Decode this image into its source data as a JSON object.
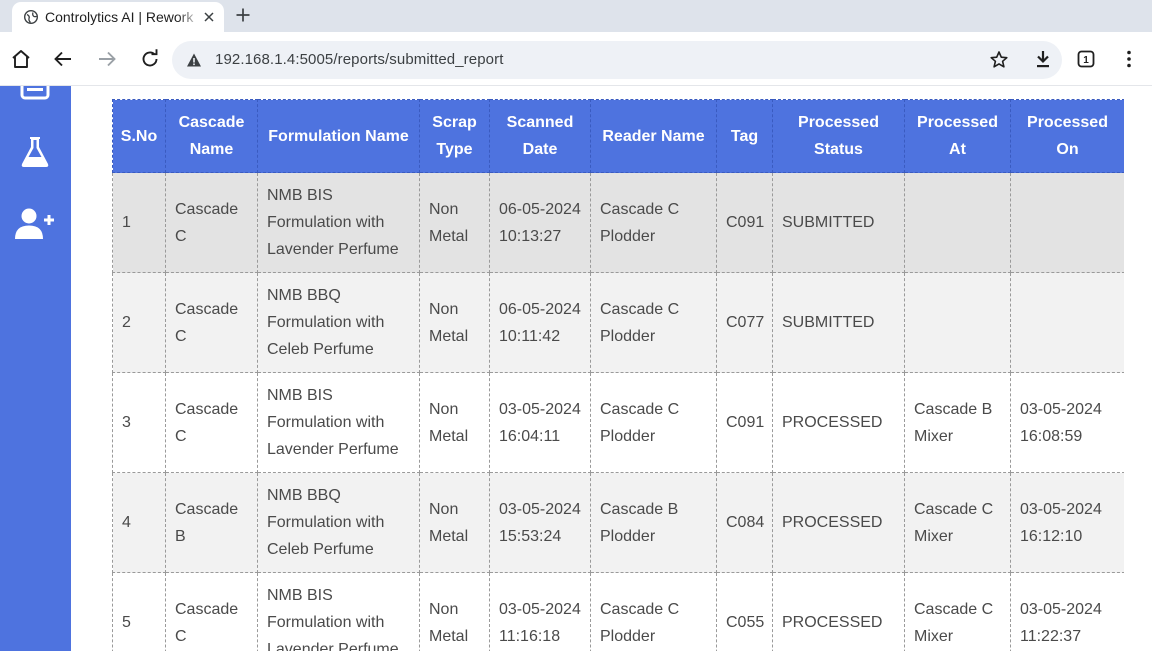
{
  "browser": {
    "tab_title": "Controlytics AI | Rework",
    "url": "192.168.1.4:5005/reports/submitted_report",
    "tab_count": "1"
  },
  "icons": {
    "sidebar": [
      "report-icon",
      "flask-icon",
      "add-user-icon"
    ]
  },
  "colors": {
    "accent": "#4e73df"
  },
  "table": {
    "headers": {
      "sno": "S.No",
      "cascade": "Cascade Name",
      "formulation": "Formulation Name",
      "scrap": "Scrap Type",
      "scanned": "Scanned Date",
      "reader": "Reader Name",
      "tag": "Tag",
      "status": "Processed Status",
      "at": "Processed At",
      "on": "Processed On"
    },
    "rows": [
      {
        "sno": "1",
        "cascade": "Cascade C",
        "formulation": "NMB BIS Formulation with Lavender Perfume",
        "scrap": "Non Metal",
        "scanned": "06-05-2024 10:13:27",
        "reader": "Cascade C Plodder",
        "tag": "C091",
        "status": "SUBMITTED",
        "at": "",
        "on": ""
      },
      {
        "sno": "2",
        "cascade": "Cascade C",
        "formulation": "NMB BBQ Formulation with Celeb Perfume",
        "scrap": "Non Metal",
        "scanned": "06-05-2024 10:11:42",
        "reader": "Cascade C Plodder",
        "tag": "C077",
        "status": "SUBMITTED",
        "at": "",
        "on": ""
      },
      {
        "sno": "3",
        "cascade": "Cascade C",
        "formulation": "NMB BIS Formulation with Lavender Perfume",
        "scrap": "Non Metal",
        "scanned": "03-05-2024 16:04:11",
        "reader": "Cascade C Plodder",
        "tag": "C091",
        "status": "PROCESSED",
        "at": "Cascade B Mixer",
        "on": "03-05-2024 16:08:59"
      },
      {
        "sno": "4",
        "cascade": "Cascade B",
        "formulation": "NMB BBQ Formulation with Celeb Perfume",
        "scrap": "Non Metal",
        "scanned": "03-05-2024 15:53:24",
        "reader": "Cascade B Plodder",
        "tag": "C084",
        "status": "PROCESSED",
        "at": "Cascade C Mixer",
        "on": "03-05-2024 16:12:10"
      },
      {
        "sno": "5",
        "cascade": "Cascade C",
        "formulation": "NMB BIS Formulation with Lavender Perfume",
        "scrap": "Non Metal",
        "scanned": "03-05-2024 11:16:18",
        "reader": "Cascade C Plodder",
        "tag": "C055",
        "status": "PROCESSED",
        "at": "Cascade C Mixer",
        "on": "03-05-2024 11:22:37"
      }
    ]
  }
}
